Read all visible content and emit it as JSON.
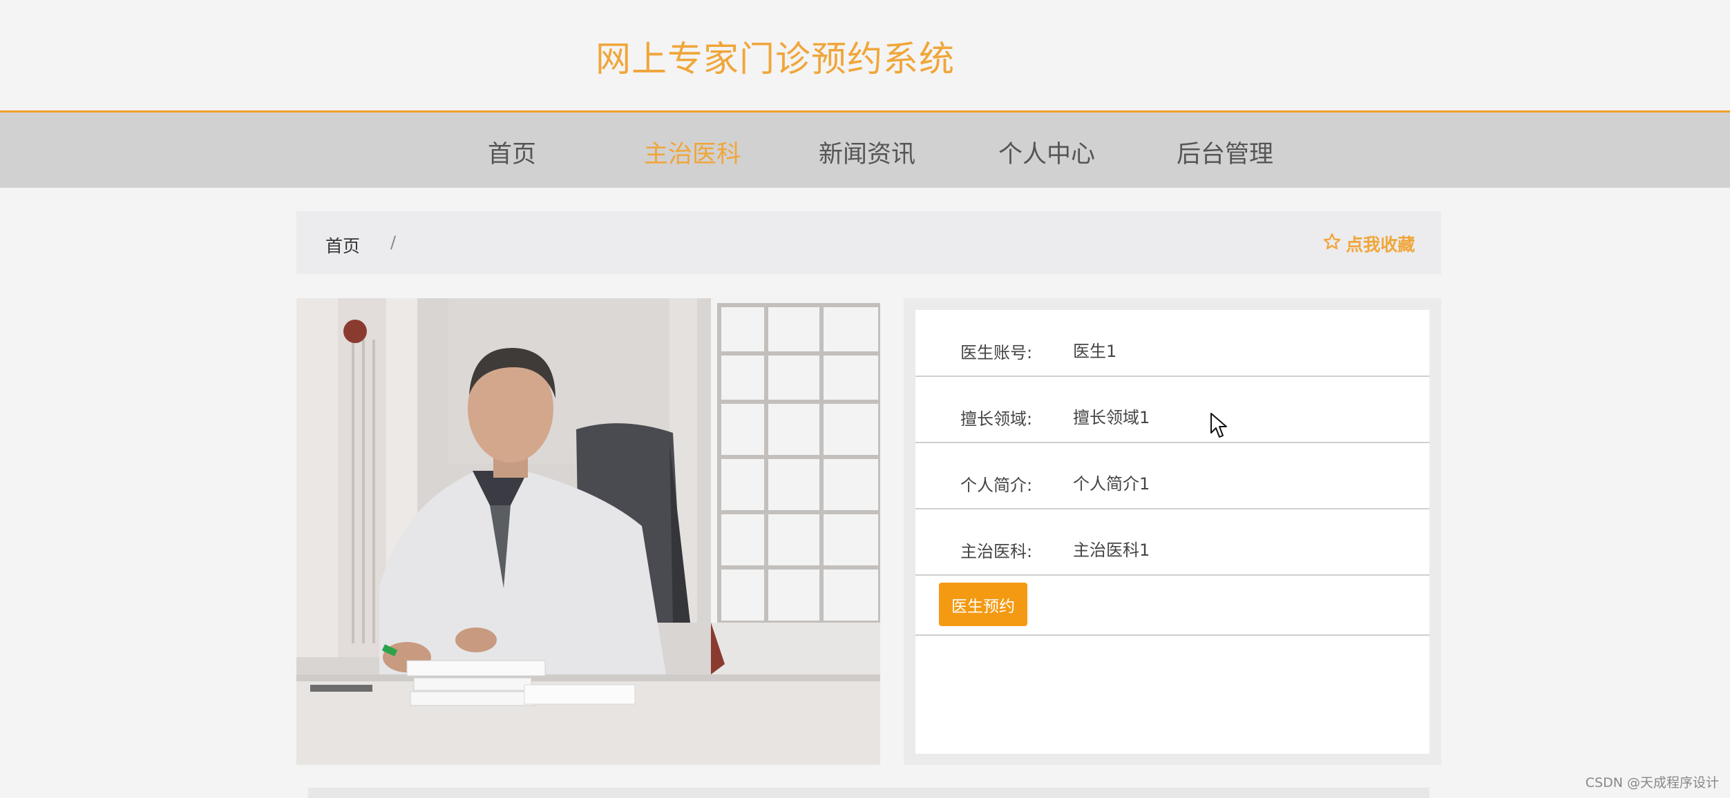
{
  "header": {
    "site_title": "网上专家门诊预约系统",
    "accent_color": "#f0a63a"
  },
  "nav": {
    "items": [
      {
        "label": "首页",
        "active": false
      },
      {
        "label": "主治医科",
        "active": true
      },
      {
        "label": "新闻资讯",
        "active": false
      },
      {
        "label": "个人中心",
        "active": false
      },
      {
        "label": "后台管理",
        "active": false
      }
    ]
  },
  "breadcrumb": {
    "home": "首页",
    "separator": "/",
    "favorite_label": "点我收藏",
    "favorite_icon": "star-outline-icon"
  },
  "doctor": {
    "photo_icon": "doctor-photo",
    "fields": [
      {
        "label": "医生账号:",
        "value": "医生1"
      },
      {
        "label": "擅长领域:",
        "value": "擅长领域1"
      },
      {
        "label": "个人简介:",
        "value": "个人简介1"
      },
      {
        "label": "主治医科:",
        "value": "主治医科1"
      }
    ],
    "book_button": "医生预约",
    "button_color": "#f39a12"
  },
  "watermark": "CSDN @天成程序设计"
}
